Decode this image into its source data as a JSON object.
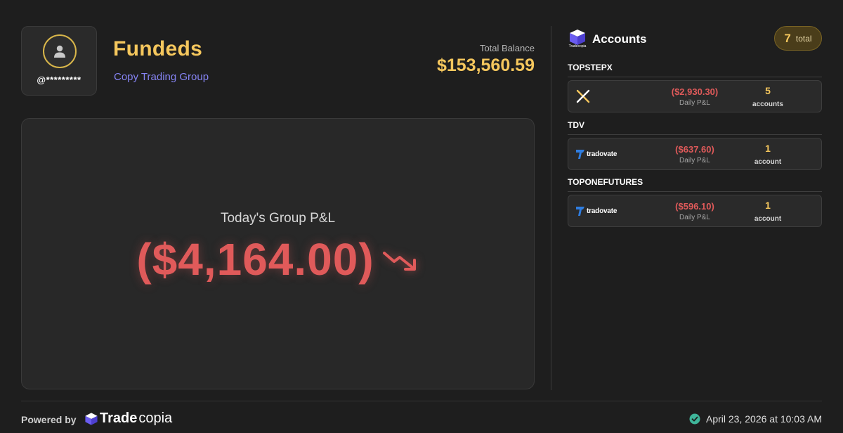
{
  "profile": {
    "handle": "@*********",
    "group_name": "Fundeds",
    "group_subtitle": "Copy Trading Group"
  },
  "balance": {
    "label": "Total Balance",
    "value": "$153,560.59"
  },
  "pnl": {
    "label": "Today's Group P&L",
    "value": "($4,164.00)",
    "trend": "down"
  },
  "accounts": {
    "title": "Accounts",
    "brand_label": "Tradecopia",
    "total_count": "7",
    "total_label": "total",
    "firms": [
      {
        "name": "TOPSTEPX",
        "platform": "topstepx",
        "platform_label": "",
        "daily_pnl": "($2,930.30)",
        "daily_pnl_label": "Daily P&L",
        "count": "5",
        "count_label": "accounts"
      },
      {
        "name": "TDV",
        "platform": "tradovate",
        "platform_label": "tradovate",
        "daily_pnl": "($637.60)",
        "daily_pnl_label": "Daily P&L",
        "count": "1",
        "count_label": "account"
      },
      {
        "name": "TOPONEFUTURES",
        "platform": "tradovate",
        "platform_label": "tradovate",
        "daily_pnl": "($596.10)",
        "daily_pnl_label": "Daily P&L",
        "count": "1",
        "count_label": "account"
      }
    ]
  },
  "footer": {
    "powered_by": "Powered by",
    "brand_part1": "Trade",
    "brand_part2": "copia",
    "timestamp": "April 23, 2026 at 10:03 AM"
  },
  "colors": {
    "background": "#1e1e1e",
    "accent_gold": "#f5c75d",
    "loss_red": "#e05a5a",
    "subtitle_purple": "#8583f2",
    "verified_green": "#3fb59a"
  },
  "icons": {
    "avatar": "user-silhouette-icon",
    "trend": "trend-down-icon",
    "brand": "cube-icon",
    "verified": "check-circle-icon"
  }
}
